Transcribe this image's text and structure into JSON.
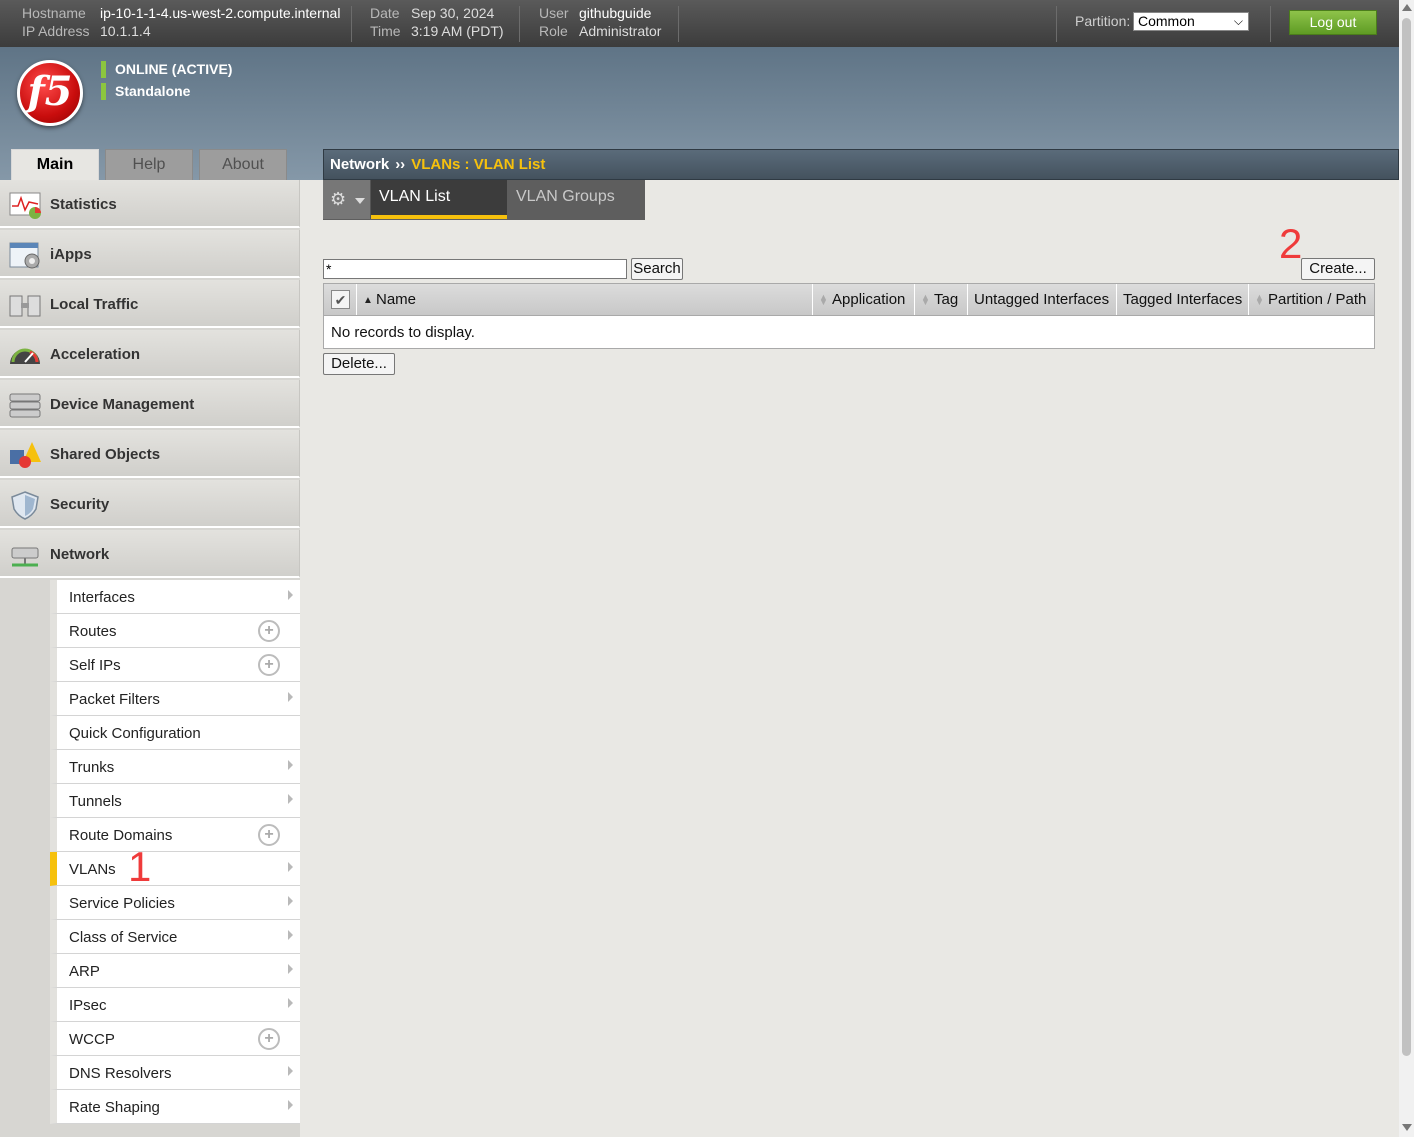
{
  "topbar": {
    "hostname_label": "Hostname",
    "hostname": "ip-10-1-1-4.us-west-2.compute.internal",
    "ip_label": "IP Address",
    "ip": "10.1.1.4",
    "date_label": "Date",
    "date": "Sep 30, 2024",
    "time_label": "Time",
    "time": "3:19 AM (PDT)",
    "user_label": "User",
    "user": "githubguide",
    "role_label": "Role",
    "role": "Administrator",
    "partition_label": "Partition:",
    "partition_value": "Common",
    "logout_label": "Log out"
  },
  "header": {
    "logo_text": "f5",
    "status": "ONLINE (ACTIVE)",
    "mode": "Standalone"
  },
  "tabs": [
    "Main",
    "Help",
    "About"
  ],
  "sidebar": {
    "items": [
      {
        "label": "Statistics",
        "icon": "statistics-icon"
      },
      {
        "label": "iApps",
        "icon": "iapps-icon"
      },
      {
        "label": "Local Traffic",
        "icon": "local-traffic-icon"
      },
      {
        "label": "Acceleration",
        "icon": "acceleration-icon"
      },
      {
        "label": "Device Management",
        "icon": "device-management-icon"
      },
      {
        "label": "Shared Objects",
        "icon": "shared-objects-icon"
      },
      {
        "label": "Security",
        "icon": "security-icon"
      },
      {
        "label": "Network",
        "icon": "network-icon"
      }
    ],
    "network_sub": [
      {
        "label": "Interfaces",
        "kind": "arrow"
      },
      {
        "label": "Routes",
        "kind": "plus"
      },
      {
        "label": "Self IPs",
        "kind": "plus"
      },
      {
        "label": "Packet Filters",
        "kind": "arrow"
      },
      {
        "label": "Quick Configuration",
        "kind": "none"
      },
      {
        "label": "Trunks",
        "kind": "arrow"
      },
      {
        "label": "Tunnels",
        "kind": "arrow"
      },
      {
        "label": "Route Domains",
        "kind": "plus"
      },
      {
        "label": "VLANs",
        "kind": "arrow",
        "selected": true
      },
      {
        "label": "Service Policies",
        "kind": "arrow"
      },
      {
        "label": "Class of Service",
        "kind": "arrow"
      },
      {
        "label": "ARP",
        "kind": "arrow"
      },
      {
        "label": "IPsec",
        "kind": "arrow"
      },
      {
        "label": "WCCP",
        "kind": "plus"
      },
      {
        "label": "DNS Resolvers",
        "kind": "arrow"
      },
      {
        "label": "Rate Shaping",
        "kind": "arrow"
      }
    ]
  },
  "breadcrumb": {
    "section": "Network",
    "separator": "››",
    "page": "VLANs : VLAN List"
  },
  "subtabs": [
    "VLAN List",
    "VLAN Groups"
  ],
  "search": {
    "value": "*",
    "button": "Search"
  },
  "create_button": "Create...",
  "delete_button": "Delete...",
  "table": {
    "columns": [
      "Name",
      "Application",
      "Tag",
      "Untagged Interfaces",
      "Tagged Interfaces",
      "Partition / Path"
    ],
    "empty_text": "No records to display."
  },
  "annotations": {
    "step1": "1",
    "step2": "2"
  },
  "colors": {
    "accent": "#f6c10d",
    "brand_red": "#e21d38",
    "logout_green": "#6aa92c",
    "annotation_red": "#ef3b3b"
  }
}
